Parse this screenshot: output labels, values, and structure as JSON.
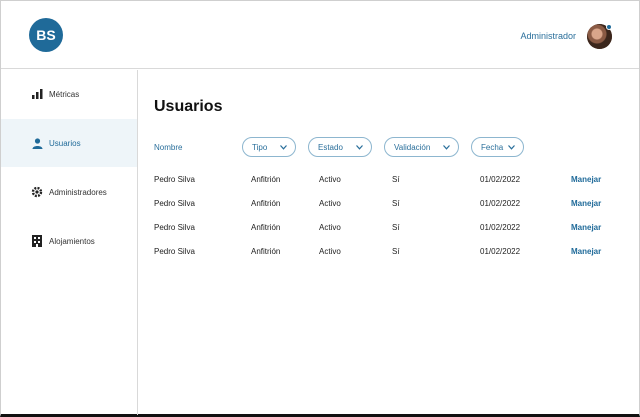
{
  "header": {
    "logo_text": "BS",
    "user_label": "Administrador"
  },
  "sidebar": {
    "items": [
      {
        "label": "Métricas",
        "icon": "bar-chart-icon",
        "active": false
      },
      {
        "label": "Usuarios",
        "icon": "user-icon",
        "active": true
      },
      {
        "label": "Administradores",
        "icon": "gear-icon",
        "active": false
      },
      {
        "label": "Alojamientos",
        "icon": "building-icon",
        "active": false
      }
    ]
  },
  "main": {
    "title": "Usuarios",
    "filters": {
      "name_label": "Nombre",
      "chips": [
        "Tipo",
        "Estado",
        "Validación",
        "Fecha"
      ]
    },
    "rows": [
      {
        "name": "Pedro Silva",
        "type": "Anfitrión",
        "status": "Activo",
        "validation": "Sí",
        "date": "01/02/2022",
        "action": "Manejar"
      },
      {
        "name": "Pedro Silva",
        "type": "Anfitrión",
        "status": "Activo",
        "validation": "Sí",
        "date": "01/02/2022",
        "action": "Manejar"
      },
      {
        "name": "Pedro Silva",
        "type": "Anfitrión",
        "status": "Activo",
        "validation": "Sí",
        "date": "01/02/2022",
        "action": "Manejar"
      },
      {
        "name": "Pedro Silva",
        "type": "Anfitrión",
        "status": "Activo",
        "validation": "Sí",
        "date": "01/02/2022",
        "action": "Manejar"
      }
    ]
  },
  "colors": {
    "accent": "#1f6a99",
    "active_bg": "#eef5f9",
    "chip_border": "#8db6cf"
  }
}
